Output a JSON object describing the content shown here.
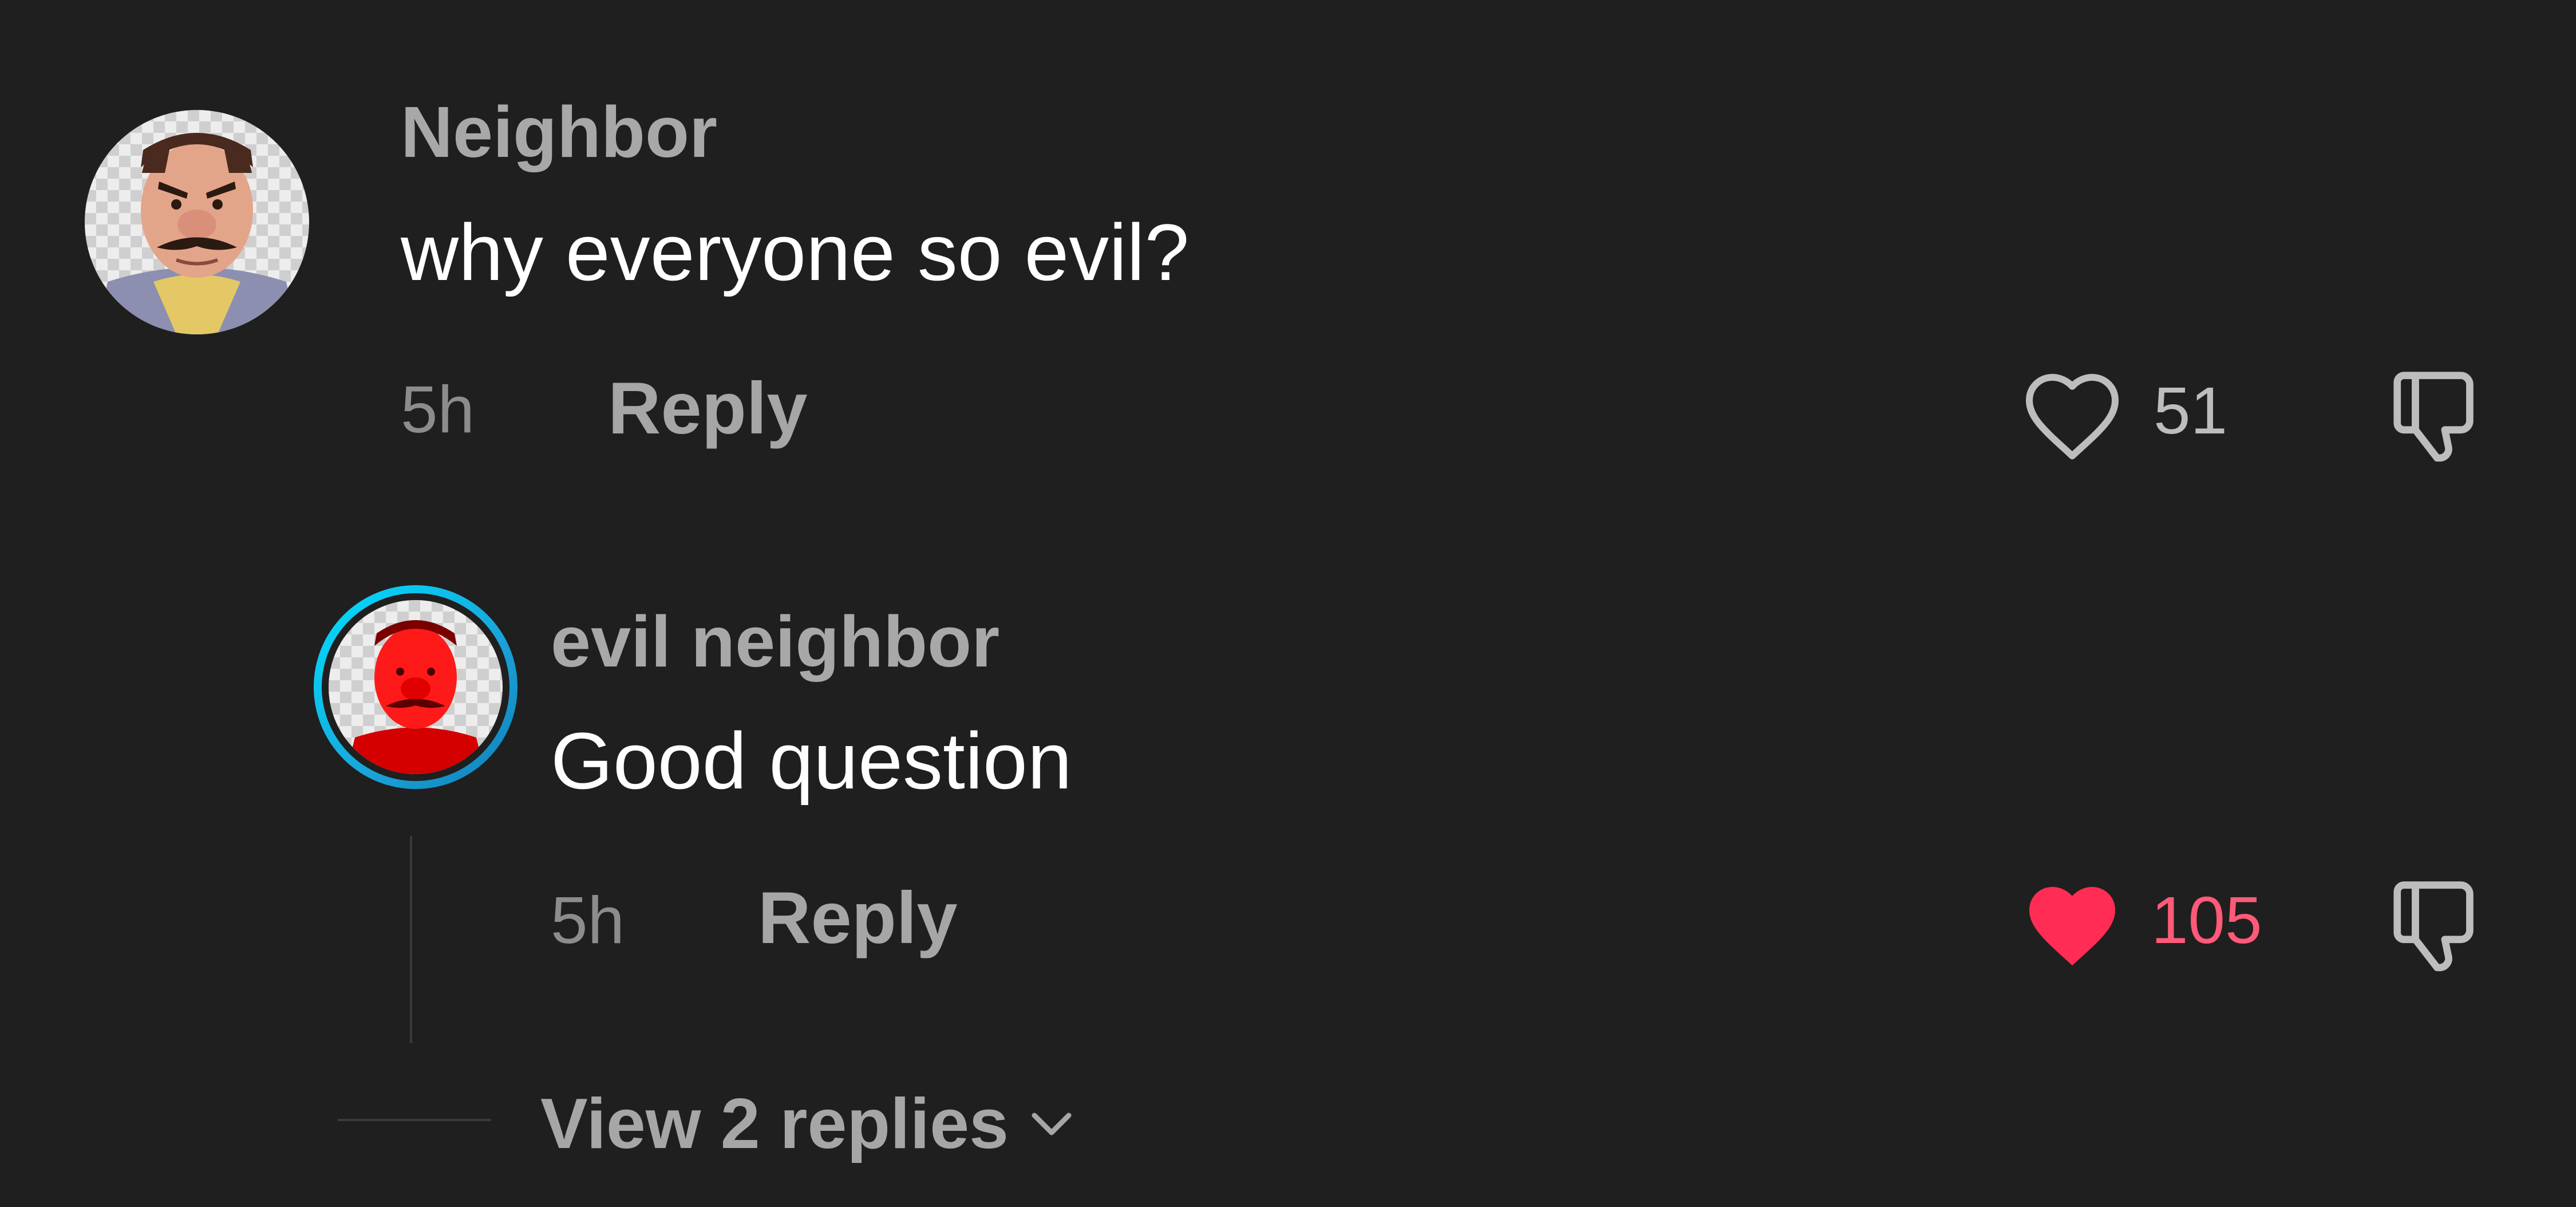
{
  "comments": [
    {
      "username": "Neighbor",
      "text": "why everyone so evil?",
      "time": "5h",
      "reply_label": "Reply",
      "likes": "51",
      "liked": false
    },
    {
      "username": "evil neighbor",
      "text": "Good question",
      "time": "5h",
      "reply_label": "Reply",
      "likes": "105",
      "liked": true
    }
  ],
  "view_replies": {
    "label": "View 2 replies",
    "icon": "chevron-down-icon"
  },
  "colors": {
    "background": "#1f1f1f",
    "like_active": "#ff2d55",
    "story_ring_from": "#00d7ff",
    "story_ring_to": "#1aa3d9"
  }
}
